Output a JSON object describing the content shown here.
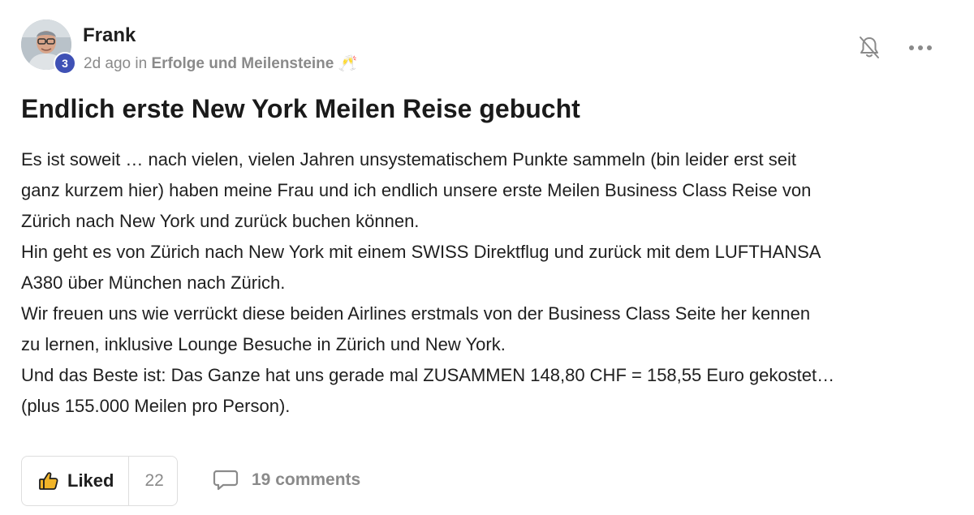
{
  "post": {
    "author": {
      "name": "Frank",
      "level": "3",
      "avatar_icon": "user-photo-avatar"
    },
    "meta": {
      "time": "2d ago",
      "in_word": "in",
      "space": "Erfolge und Meilensteine",
      "space_emoji": "🥂"
    },
    "title": "Endlich erste New York Meilen Reise gebucht",
    "body_lines": [
      "Es ist soweit … nach vielen, vielen Jahren unsystematischem Punkte sammeln (bin leider erst seit",
      "ganz kurzem hier) haben meine Frau und ich endlich unsere erste Meilen Business Class Reise von",
      "Zürich nach New York und zurück buchen können.",
      "Hin geht es von Zürich nach New York mit einem SWISS Direktflug und zurück mit dem LUFTHANSA",
      "A380 über München nach Zürich.",
      "Wir freuen uns wie verrückt diese beiden Airlines erstmals von der Business Class Seite her kennen",
      "zu lernen, inklusive Lounge Besuche in Zürich und New York.",
      "Und das Beste ist: Das Ganze hat uns gerade mal ZUSAMMEN 148,80 CHF = 158,55 Euro gekostet…",
      "(plus 155.000 Meilen pro Person)."
    ],
    "actions": {
      "like_label": "Liked",
      "like_count": "22",
      "comments_label": "19 comments"
    },
    "icons": {
      "bell": "bell-muted-icon",
      "more": "more-horizontal-icon",
      "like": "thumbs-up-icon",
      "comment": "comment-bubble-icon"
    },
    "colors": {
      "badge": "#3f51b5",
      "like_icon": "#f0b429",
      "muted_text": "#8a8a8a"
    }
  }
}
